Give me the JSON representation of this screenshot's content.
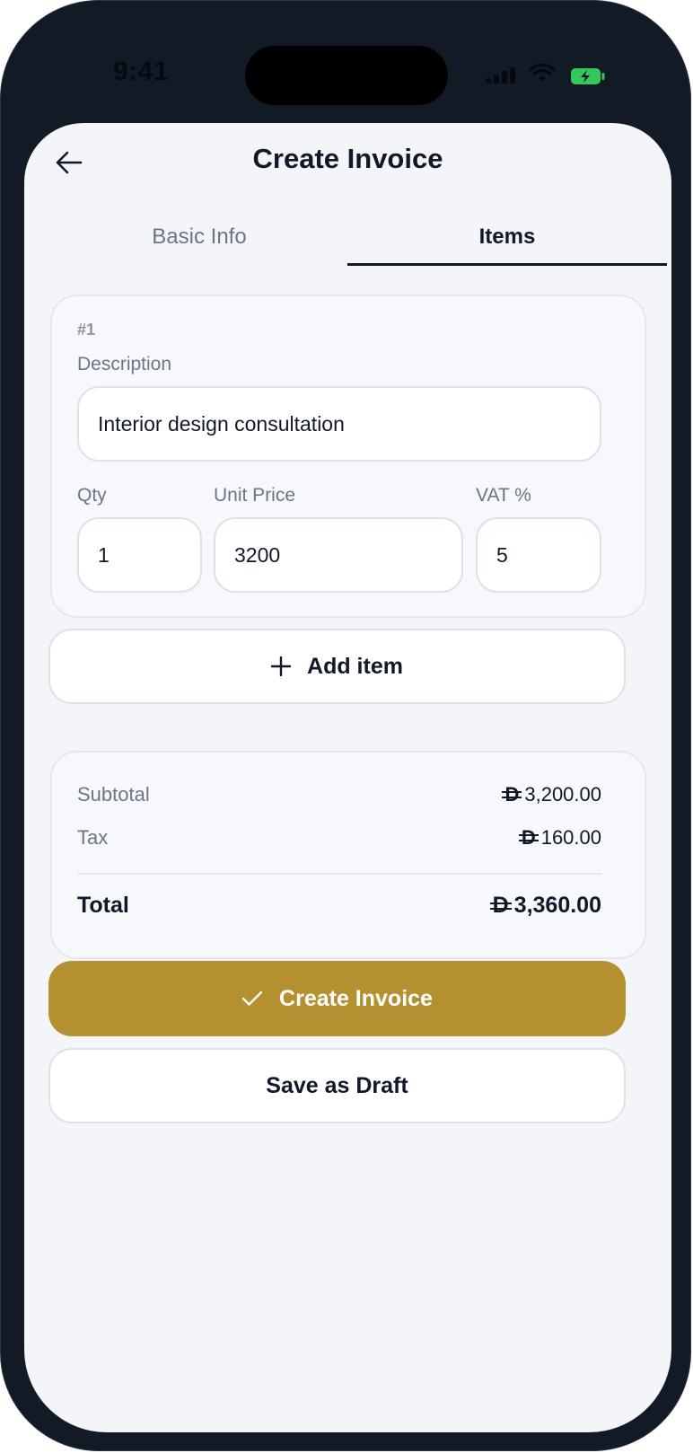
{
  "status_bar": {
    "time": "9:41"
  },
  "header": {
    "title": "Create Invoice"
  },
  "tabs": [
    {
      "label": "Basic Info",
      "active": false
    },
    {
      "label": "Items",
      "active": true
    }
  ],
  "item": {
    "number": "#1",
    "description_label": "Description",
    "description_value": "Interior design consultation",
    "qty_label": "Qty",
    "qty_value": "1",
    "unit_price_label": "Unit Price",
    "unit_price_value": "3200",
    "vat_label": "VAT %",
    "vat_value": "5"
  },
  "add_item_label": "Add item",
  "summary": {
    "currency_symbol": "D",
    "subtotal_label": "Subtotal",
    "subtotal_value": "3,200.00",
    "tax_label": "Tax",
    "tax_value": "160.00",
    "total_label": "Total",
    "total_value": "3,360.00"
  },
  "actions": {
    "create_label": "Create Invoice",
    "draft_label": "Save as Draft"
  },
  "colors": {
    "accent": "#b59031",
    "battery": "#34c759",
    "frame": "#121a26",
    "screen_bg": "#f3f5f9"
  }
}
